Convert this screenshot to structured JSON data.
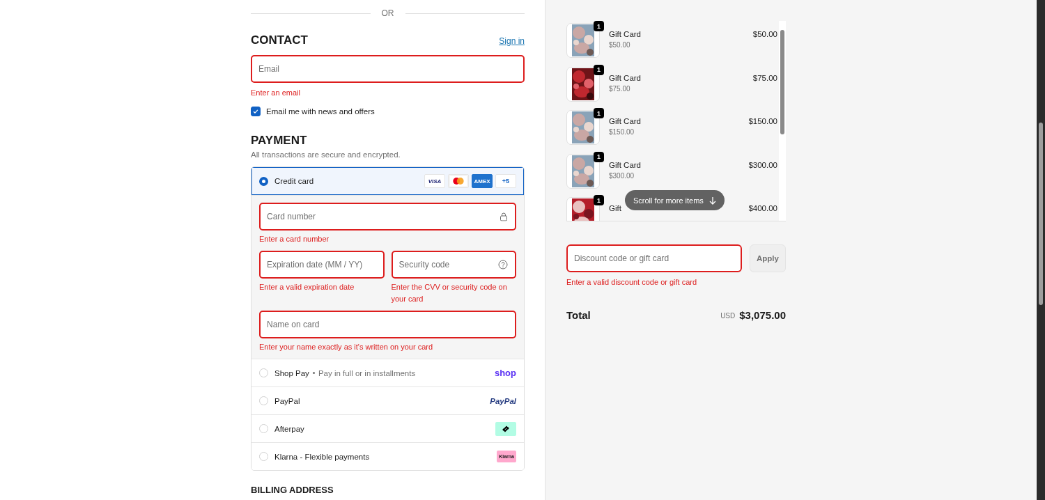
{
  "divider_label": "OR",
  "contact": {
    "heading": "CONTACT",
    "sign_in": "Sign in",
    "email": {
      "placeholder": "Email",
      "error": "Enter an email"
    },
    "newsletter": {
      "label": "Email me with news and offers",
      "checked": true
    }
  },
  "payment": {
    "heading": "PAYMENT",
    "subtitle": "All transactions are secure and encrypted.",
    "methods": [
      {
        "kind": "card",
        "label": "Credit card",
        "selected": true,
        "brands": [
          {
            "kind": "visa",
            "label": "VISA"
          },
          {
            "kind": "mastercard"
          },
          {
            "kind": "amex",
            "label": "AMEX"
          },
          {
            "kind": "more",
            "label": "+5"
          }
        ],
        "fields": [
          {
            "kind": "lock",
            "placeholder": "Card number",
            "error": "Enter a card number"
          },
          {
            "kind": "half",
            "placeholder": "Expiration date (MM / YY)",
            "error": "Enter a valid expiration date"
          },
          {
            "kind": "help",
            "placeholder": "Security code",
            "error": "Enter the CVV or security code on your card"
          },
          {
            "kind": "full",
            "placeholder": "Name on card",
            "error": "Enter your name exactly as it's written on your card"
          }
        ]
      },
      {
        "kind": "shop",
        "label": "Shop Pay",
        "note": "Pay in full or in installments",
        "logo": "shop",
        "selected": false
      },
      {
        "kind": "paypal",
        "label": "PayPal",
        "logo": "PayPal",
        "selected": false
      },
      {
        "kind": "afterpay",
        "label": "Afterpay",
        "selected": false
      },
      {
        "kind": "klarna",
        "label": "Klarna - Flexible payments",
        "logo": "Klarna",
        "selected": false
      }
    ]
  },
  "billing_heading": "BILLING ADDRESS",
  "order": {
    "items": [
      {
        "quantity": "1",
        "name": "Gift Card",
        "subtitle": "$50.00",
        "price": "$50.00"
      },
      {
        "quantity": "1",
        "name": "Gift Card",
        "subtitle": "$75.00",
        "price": "$75.00"
      },
      {
        "quantity": "1",
        "name": "Gift Card",
        "subtitle": "$150.00",
        "price": "$150.00"
      },
      {
        "quantity": "1",
        "name": "Gift Card",
        "subtitle": "$300.00",
        "price": "$300.00"
      },
      {
        "quantity": "1",
        "name": "Gift",
        "price": "$400.00"
      }
    ],
    "scroll_hint": "Scroll for more items",
    "discount": {
      "placeholder": "Discount code or gift card",
      "error": "Enter a valid discount code or gift card",
      "button": "Apply"
    },
    "total": {
      "label": "Total",
      "currency": "USD",
      "amount": "$3,075.00"
    }
  }
}
